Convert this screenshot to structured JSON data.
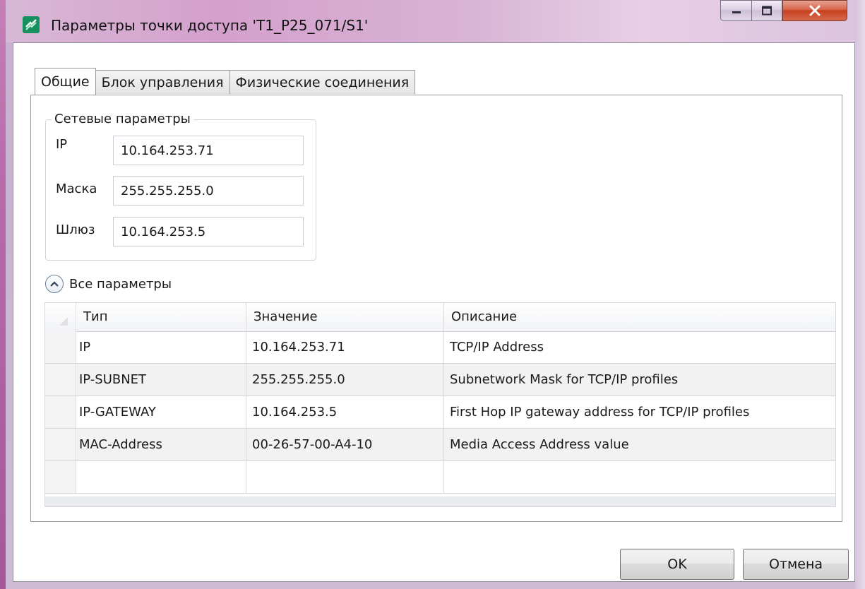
{
  "window": {
    "title": "Параметры точки доступа 'T1_P25_071/S1'",
    "app_icon": "network-icon",
    "controls": {
      "minimize": "minimize-icon",
      "maximize": "maximize-icon",
      "close": "close-icon"
    }
  },
  "tabs": [
    {
      "label": "Общие",
      "active": true
    },
    {
      "label": "Блок управления",
      "active": false
    },
    {
      "label": "Физические соединения",
      "active": false
    }
  ],
  "network": {
    "group_label": "Сетевые параметры",
    "ip_label": "IP",
    "ip_value": "10.164.253.71",
    "mask_label": "Маска",
    "mask_value": "255.255.255.0",
    "gateway_label": "Шлюз",
    "gateway_value": "10.164.253.5"
  },
  "all_params": {
    "label": "Все параметры",
    "expander_icon": "chevron-up-icon",
    "expanded": true
  },
  "grid": {
    "columns": [
      "Тип",
      "Значение",
      "Описание"
    ],
    "rows": [
      {
        "type": "IP",
        "value": "10.164.253.71",
        "description": "TCP/IP Address"
      },
      {
        "type": "IP-SUBNET",
        "value": "255.255.255.0",
        "description": "Subnetwork Mask for TCP/IP profiles"
      },
      {
        "type": "IP-GATEWAY",
        "value": "10.164.253.5",
        "description": "First Hop IP gateway address for TCP/IP profiles"
      },
      {
        "type": "MAC-Address",
        "value": "00-26-57-00-A4-10",
        "description": "Media Access Address value"
      },
      {
        "type": "",
        "value": "",
        "description": ""
      }
    ]
  },
  "buttons": {
    "ok": "OK",
    "cancel": "Отмена"
  },
  "colors": {
    "close_button": "#c5401f",
    "app_icon": "#15905f",
    "frame_accent": "#b96aa9"
  }
}
